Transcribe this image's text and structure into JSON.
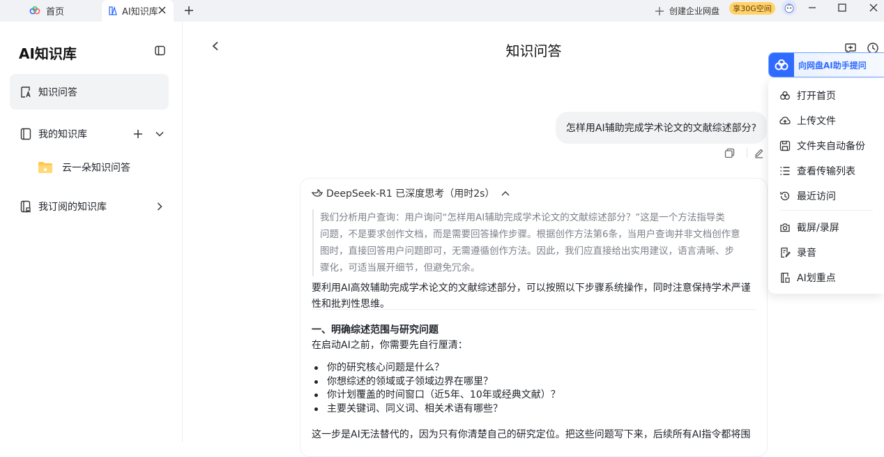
{
  "titlebar": {
    "home_tab_label": "首页",
    "ai_tab_label": "AI知识库",
    "create_enterprise_label": "创建企业网盘",
    "promo_badge": "享30G空间"
  },
  "sidebar": {
    "title": "AI知识库",
    "items": [
      {
        "label": "知识问答",
        "icon": "knowledge-qa-icon"
      },
      {
        "label": "我的知识库",
        "icon": "book-icon"
      },
      {
        "label": "我订阅的知识库",
        "icon": "subscribe-icon"
      }
    ],
    "sub_item_label": "云一朵知识问答"
  },
  "main": {
    "title": "知识问答",
    "user_question": "怎样用AI辅助完成学术论文的文献综述部分?",
    "think_header": "DeepSeek-R1 已深度思考（用时2s）",
    "think_lines": [
      "我们分析用户查询：用户询问“怎样用AI辅助完成学术论文的文献综述部分？”这是一个方法指导类",
      "问题，不是要求创作文档，而是需要回答操作步骤。根据创作方法第6条，当用户查询并非文档创作意",
      "图时，直接回答用户问题即可，无需遵循创作方法。因此，我们应直接给出实用建议，语言清晰、步",
      "骤化，可适当展开细节，但避免冗余。"
    ],
    "answer_intro_lines": [
      "要利用AI高效辅助完成学术论文的文献综述部分，可以按照以下步骤系统操作，同时注意保持学术严谨",
      "性和批判性思维。"
    ],
    "section_title": "一、明确综述范围与研究问题",
    "section_sub": "在启动AI之前，你需要先自行厘清：",
    "bullets": [
      "你的研究核心问题是什么？",
      "你想综述的领域或子领域边界在哪里？",
      "你计划覆盖的时间窗口（近5年、10年或经典文献）？",
      "主要关键词、同义词、相关术语有哪些？"
    ],
    "answer_tail": "这一步是AI无法替代的，因为只有你清楚自己的研究定位。把这些问题写下来，后续所有AI指令都将围"
  },
  "side_menu": {
    "ask_label": "向网盘AI助手提问",
    "items": [
      {
        "label": "打开首页",
        "icon": "home-icon"
      },
      {
        "label": "上传文件",
        "icon": "upload-cloud-icon"
      },
      {
        "label": "文件夹自动备份",
        "icon": "backup-icon"
      },
      {
        "label": "查看传输列表",
        "icon": "list-icon"
      },
      {
        "label": "最近访问",
        "icon": "history-icon"
      },
      {
        "label": "截屏/录屏",
        "icon": "camera-icon"
      },
      {
        "label": "录音",
        "icon": "record-icon"
      },
      {
        "label": "AI划重点",
        "icon": "ai-highlight-icon"
      }
    ]
  },
  "colors": {
    "accent": "#2f6bff",
    "promo": "#ffd36b",
    "active_bg": "#f2f3f5"
  }
}
